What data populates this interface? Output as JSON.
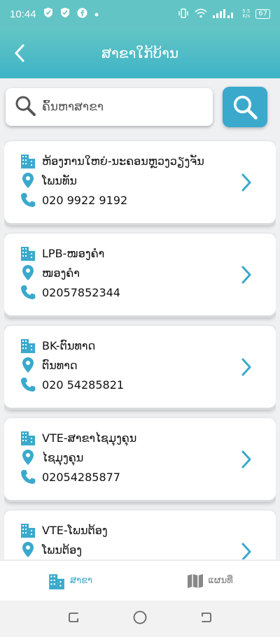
{
  "status_bar": {
    "time": "10:44",
    "net_speed": "5.5\nK/s",
    "battery": "67"
  },
  "header": {
    "title": "ສາຂາໃກ້ບ້ານ"
  },
  "search": {
    "placeholder": "ຄົ້ນຫາສາຂາ"
  },
  "branches": [
    {
      "name": "ຫ້ອງການໃຫຍ່-ນະຄອນຫຼວງວຽງຈັນ",
      "location": "ໂພນທັນ",
      "phone": "020 9922 9192"
    },
    {
      "name": "LPB-ໜອງຄໍາ",
      "location": "ໜອງຄໍາ",
      "phone": "02057852344"
    },
    {
      "name": "BK-ຕົນທາດ",
      "location": "ຕົນທາດ",
      "phone": "020 54285821"
    },
    {
      "name": "VTE-ສາຂາໄຊມຸງຄຸນ",
      "location": "ໄຊມຸງຄຸນ",
      "phone": "02054285877"
    },
    {
      "name": "VTE-ໂພນຕ້ອງ",
      "location": "ໂພນຕ້ອງ",
      "phone": ""
    }
  ],
  "bottom_nav": {
    "branches_label": "ສາຂາ",
    "map_label": "ແຜນທີ່"
  },
  "colors": {
    "accent": "#3aa9cc",
    "header_top": "#64c6c5",
    "header_bottom": "#3db3c6"
  }
}
